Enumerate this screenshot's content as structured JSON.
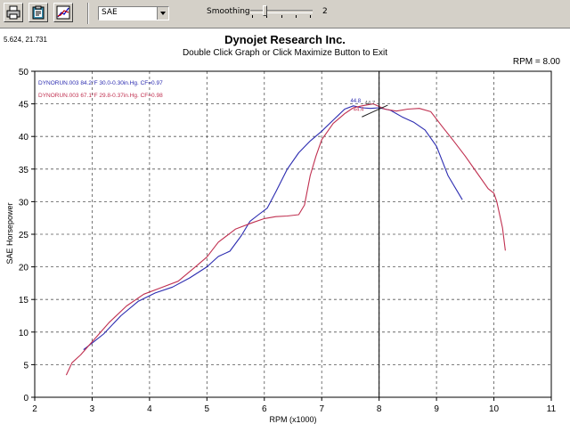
{
  "toolbar": {
    "buttons": [
      "print-icon",
      "clipboard-icon",
      "graph-options-icon"
    ],
    "units_select": "SAE",
    "smoothing_label": "Smoothing",
    "smoothing_value": "2"
  },
  "cursor_readout": "5.624, 21.731",
  "rpm_readout": "RPM = 8.00",
  "cursor_rpm": 8.0,
  "chart_data": {
    "type": "line",
    "title": "Dynojet Research Inc.",
    "subtitle": "Double Click Graph or Click Maximize Button to Exit",
    "xlabel": "RPM (x1000)",
    "ylabel": "SAE Horsepower",
    "xlim": [
      2,
      11
    ],
    "ylim": [
      0,
      50
    ],
    "xticks": [
      "2",
      "3",
      "4",
      "5",
      "6",
      "7",
      "8",
      "9",
      "10",
      "11"
    ],
    "yticks": [
      "0",
      "5",
      "10",
      "15",
      "20",
      "25",
      "30",
      "35",
      "40",
      "45",
      "50"
    ],
    "grid": true,
    "series": [
      {
        "name": "DYNORUN.003  84.2°F  30.0-0.30in.Hg.  CF=0.97",
        "color": "#2b2bb0",
        "x": [
          2.85,
          3.0,
          3.2,
          3.5,
          3.8,
          4.1,
          4.4,
          4.7,
          5.0,
          5.2,
          5.4,
          5.6,
          5.75,
          5.9,
          6.05,
          6.2,
          6.4,
          6.6,
          6.8,
          7.0,
          7.2,
          7.4,
          7.55,
          7.7,
          7.85,
          8.0,
          8.2,
          8.4,
          8.6,
          8.8,
          9.0,
          9.2,
          9.45
        ],
        "y": [
          7.3,
          8.3,
          9.7,
          12.5,
          14.7,
          16.0,
          16.9,
          18.3,
          20.0,
          21.6,
          22.4,
          24.8,
          27.0,
          28.0,
          29.0,
          31.5,
          35.0,
          37.5,
          39.3,
          40.8,
          42.5,
          44.2,
          44.7,
          44.4,
          44.3,
          44.4,
          44.0,
          43.0,
          42.2,
          41.0,
          38.5,
          34.0,
          30.3
        ]
      },
      {
        "name": "DYNORUN.003  67.1°F  29.8-0.37in.Hg.  CF=0.98",
        "color": "#c03050",
        "x": [
          2.55,
          2.65,
          2.8,
          3.0,
          3.3,
          3.6,
          3.9,
          4.2,
          4.5,
          4.8,
          5.0,
          5.2,
          5.5,
          5.8,
          6.0,
          6.2,
          6.4,
          6.6,
          6.7,
          6.8,
          6.9,
          7.0,
          7.2,
          7.4,
          7.55,
          7.7,
          7.9,
          8.1,
          8.3,
          8.5,
          8.7,
          8.9,
          9.1,
          9.3,
          9.5,
          9.7,
          9.9,
          10.0,
          10.05,
          10.1,
          10.15,
          10.2
        ],
        "y": [
          3.4,
          5.3,
          6.5,
          8.5,
          11.5,
          14.0,
          15.8,
          16.8,
          17.8,
          20.0,
          21.5,
          23.8,
          25.8,
          26.8,
          27.4,
          27.7,
          27.8,
          28.0,
          29.5,
          34.0,
          37.0,
          39.5,
          42.0,
          43.5,
          44.4,
          44.7,
          45.0,
          44.2,
          43.9,
          44.2,
          44.3,
          43.8,
          41.5,
          39.3,
          37.0,
          34.5,
          32.0,
          31.3,
          30.0,
          28.0,
          26.0,
          22.5
        ]
      }
    ],
    "annotations": [
      "44.8",
      "44.4",
      "44.7"
    ]
  }
}
